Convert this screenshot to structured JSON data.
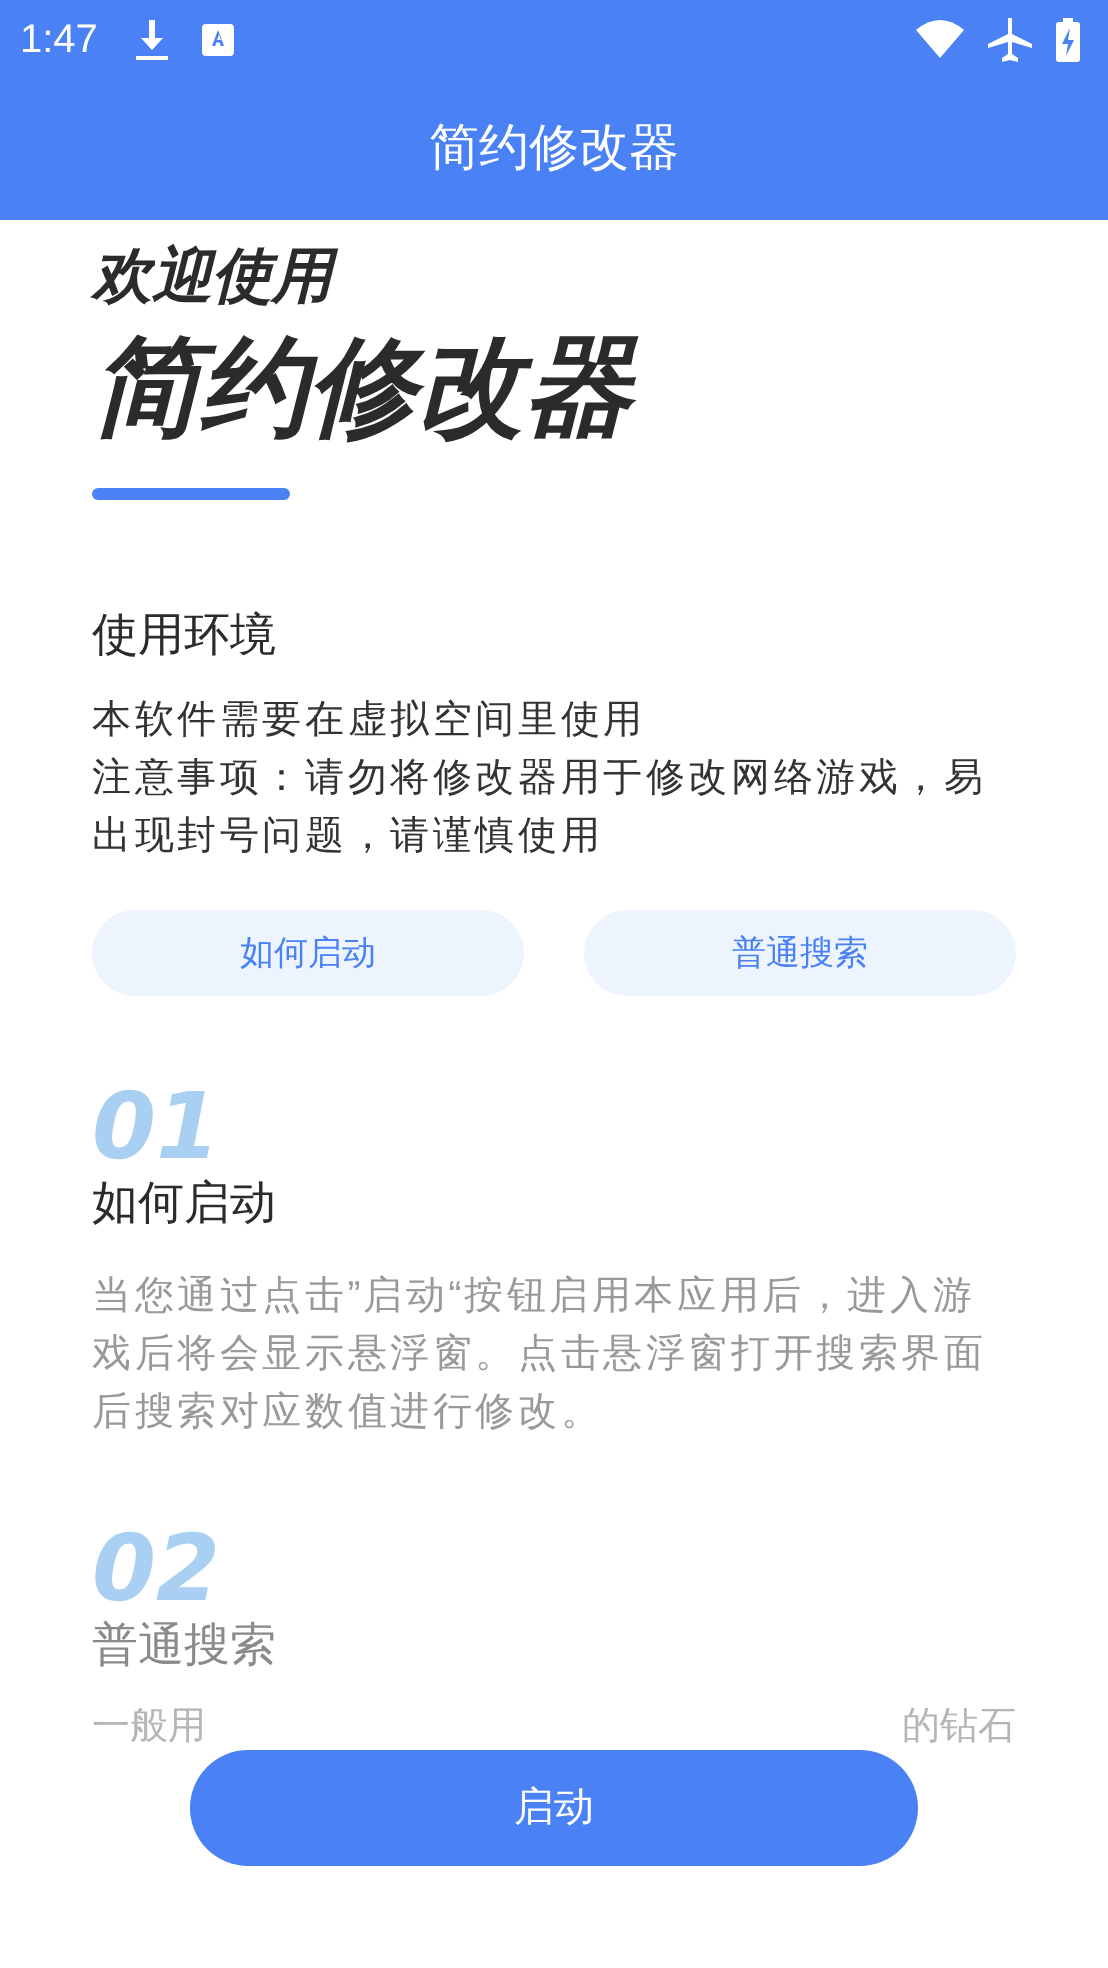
{
  "status_bar": {
    "time": "1:47"
  },
  "app_bar": {
    "title": "简约修改器"
  },
  "hero": {
    "welcome": "欢迎使用",
    "app_name": "简约修改器"
  },
  "environment": {
    "title": "使用环境",
    "lines": [
      "本软件需要在虚拟空间里使用",
      "注意事项：请勿将修改器用于修改网络游戏，易出现封号问题，请谨慎使用"
    ]
  },
  "quick_links": [
    "如何启动",
    "普通搜索"
  ],
  "sections": [
    {
      "number": "01",
      "title": "如何启动",
      "faded": false,
      "body": [
        "当您通过点击”启动“按钮启用本应用后，进入游戏后将会显示悬浮窗。点击悬浮窗打开搜索界面后搜索对应数值进行修改。"
      ]
    },
    {
      "number": "02",
      "title": "普通搜索",
      "faded": true,
      "body": [
        "一般用",
        "的钻石"
      ]
    }
  ],
  "start_button": {
    "label": "启动"
  }
}
